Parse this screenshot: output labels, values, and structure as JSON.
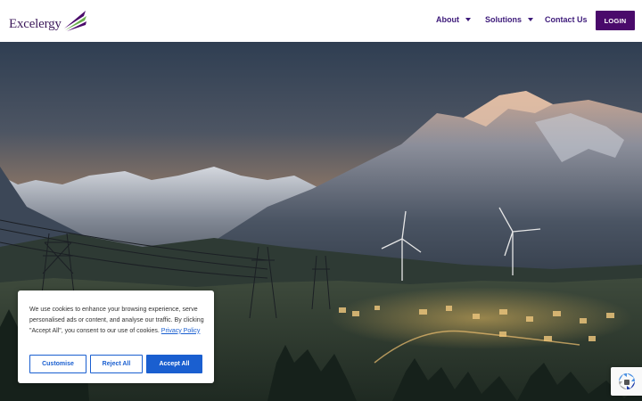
{
  "header": {
    "logo_text": "Excelergy",
    "nav": [
      {
        "label": "About",
        "has_dropdown": true
      },
      {
        "label": "Solutions",
        "has_dropdown": true
      },
      {
        "label": "Contact Us",
        "has_dropdown": false
      }
    ],
    "login_label": "LOGIN"
  },
  "colors": {
    "brand_purple": "#4a0a6b",
    "nav_text": "#3d1a7a",
    "cookie_accent": "#1a5fd0",
    "logo_green": "#6ab04c"
  },
  "cookie_banner": {
    "message": "We use cookies to enhance your browsing experience, serve personalised ads or content, and analyse our traffic. By clicking \"Accept All\", you consent to our use of cookies.",
    "privacy_link": "Privacy Policy",
    "buttons": {
      "customise": "Customise",
      "reject": "Reject All",
      "accept": "Accept All"
    }
  },
  "hero": {
    "image": "mountain-valley-wind-turbines-dusk"
  },
  "icons": {
    "recaptcha": "recaptcha-icon",
    "caret": "chevron-down-icon"
  }
}
